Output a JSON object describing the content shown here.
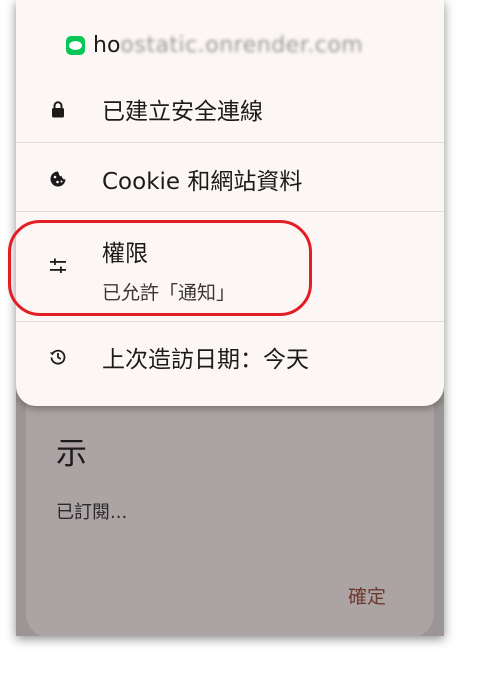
{
  "site": {
    "host_visible": "ho",
    "host_obscured": "ostatic.onrender.com"
  },
  "menu": {
    "secure_label": "已建立安全連線",
    "cookie_label": "Cookie 和網站資料",
    "permissions_label": "權限",
    "permissions_sub": "已允許「通知」",
    "last_visit_label": "上次造訪日期：今天"
  },
  "dialog": {
    "title": "示",
    "body": "已訂閱...",
    "ok_label": "確定"
  },
  "icons": [
    "line-app-icon",
    "lock-icon",
    "cookie-icon",
    "tune-icon",
    "history-icon"
  ],
  "colors": {
    "highlight": "#e31d24",
    "line_green": "#06c755",
    "dialog_button": "#6d3a2e"
  }
}
